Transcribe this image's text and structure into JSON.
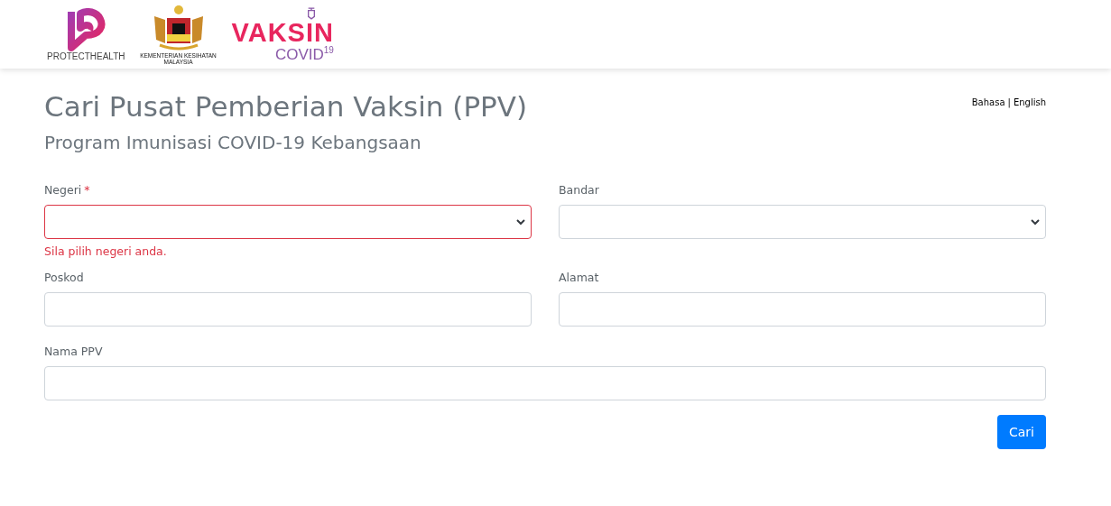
{
  "header": {
    "logos": [
      {
        "kind": "protecthealth",
        "text": "PROTECTHEALTH"
      },
      {
        "kind": "crest",
        "text": "KEMENTERIAN KESIHATAN MALAYSIA"
      },
      {
        "kind": "vaksin",
        "text": "VAKSIN",
        "subtext": "COVID",
        "sup": "19"
      }
    ]
  },
  "language_switch": {
    "items": [
      "Bahasa",
      "English"
    ],
    "separator": "|"
  },
  "title": "Cari Pusat Pemberian Vaksin (PPV)",
  "subtitle": "Program Imunisasi COVID-19 Kebangsaan",
  "fields": [
    {
      "label": "Negeri",
      "required_mark": "*",
      "kind": "select",
      "invalid": true,
      "error": "Sila pilih negeri anda."
    },
    {
      "label": "Bandar",
      "kind": "select",
      "invalid": false
    },
    {
      "label": "Poskod",
      "kind": "input",
      "invalid": false
    },
    {
      "label": "Alamat",
      "kind": "input",
      "invalid": false
    },
    {
      "label": "Nama PPV",
      "kind": "input",
      "invalid": false
    }
  ],
  "submit": "Cari"
}
